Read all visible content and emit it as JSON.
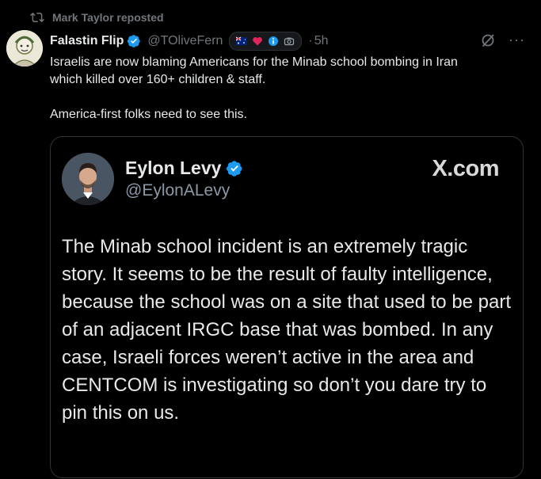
{
  "repost": {
    "text": "Mark Taylor reposted",
    "icon": "repost-icon"
  },
  "post": {
    "author_name": "Falastin Flip",
    "handle": "@TOliveFern",
    "badges": [
      "australia-flag-icon",
      "heart-icon",
      "info-icon",
      "camera-icon"
    ],
    "separator": "·",
    "time": "5h",
    "text": "Israelis are now blaming Americans for the Minab school bombing in Iran\nwhich killed over 160+ children & staff.\n\nAmerica-first folks need to see this.",
    "actions": [
      "grok-icon",
      "more-icon"
    ],
    "more_label": "···"
  },
  "quote": {
    "author_name": "Eylon Levy",
    "handle": "@EylonALevy",
    "brand": "X.com",
    "text": "The Minab school incident is an extremely tragic story. It seems to be the result of faulty intelligence, because the school was on a site that used to be part of an adjacent IRGC base that was bombed. In any case, Israeli forces weren’t active in the area and CENTCOM is investigating so don’t you dare try to pin this on us."
  },
  "colors": {
    "background": "#000000",
    "text": "#e7e9ea",
    "muted": "#71767b",
    "verified": "#1d9bf0",
    "border": "#2f3336"
  }
}
